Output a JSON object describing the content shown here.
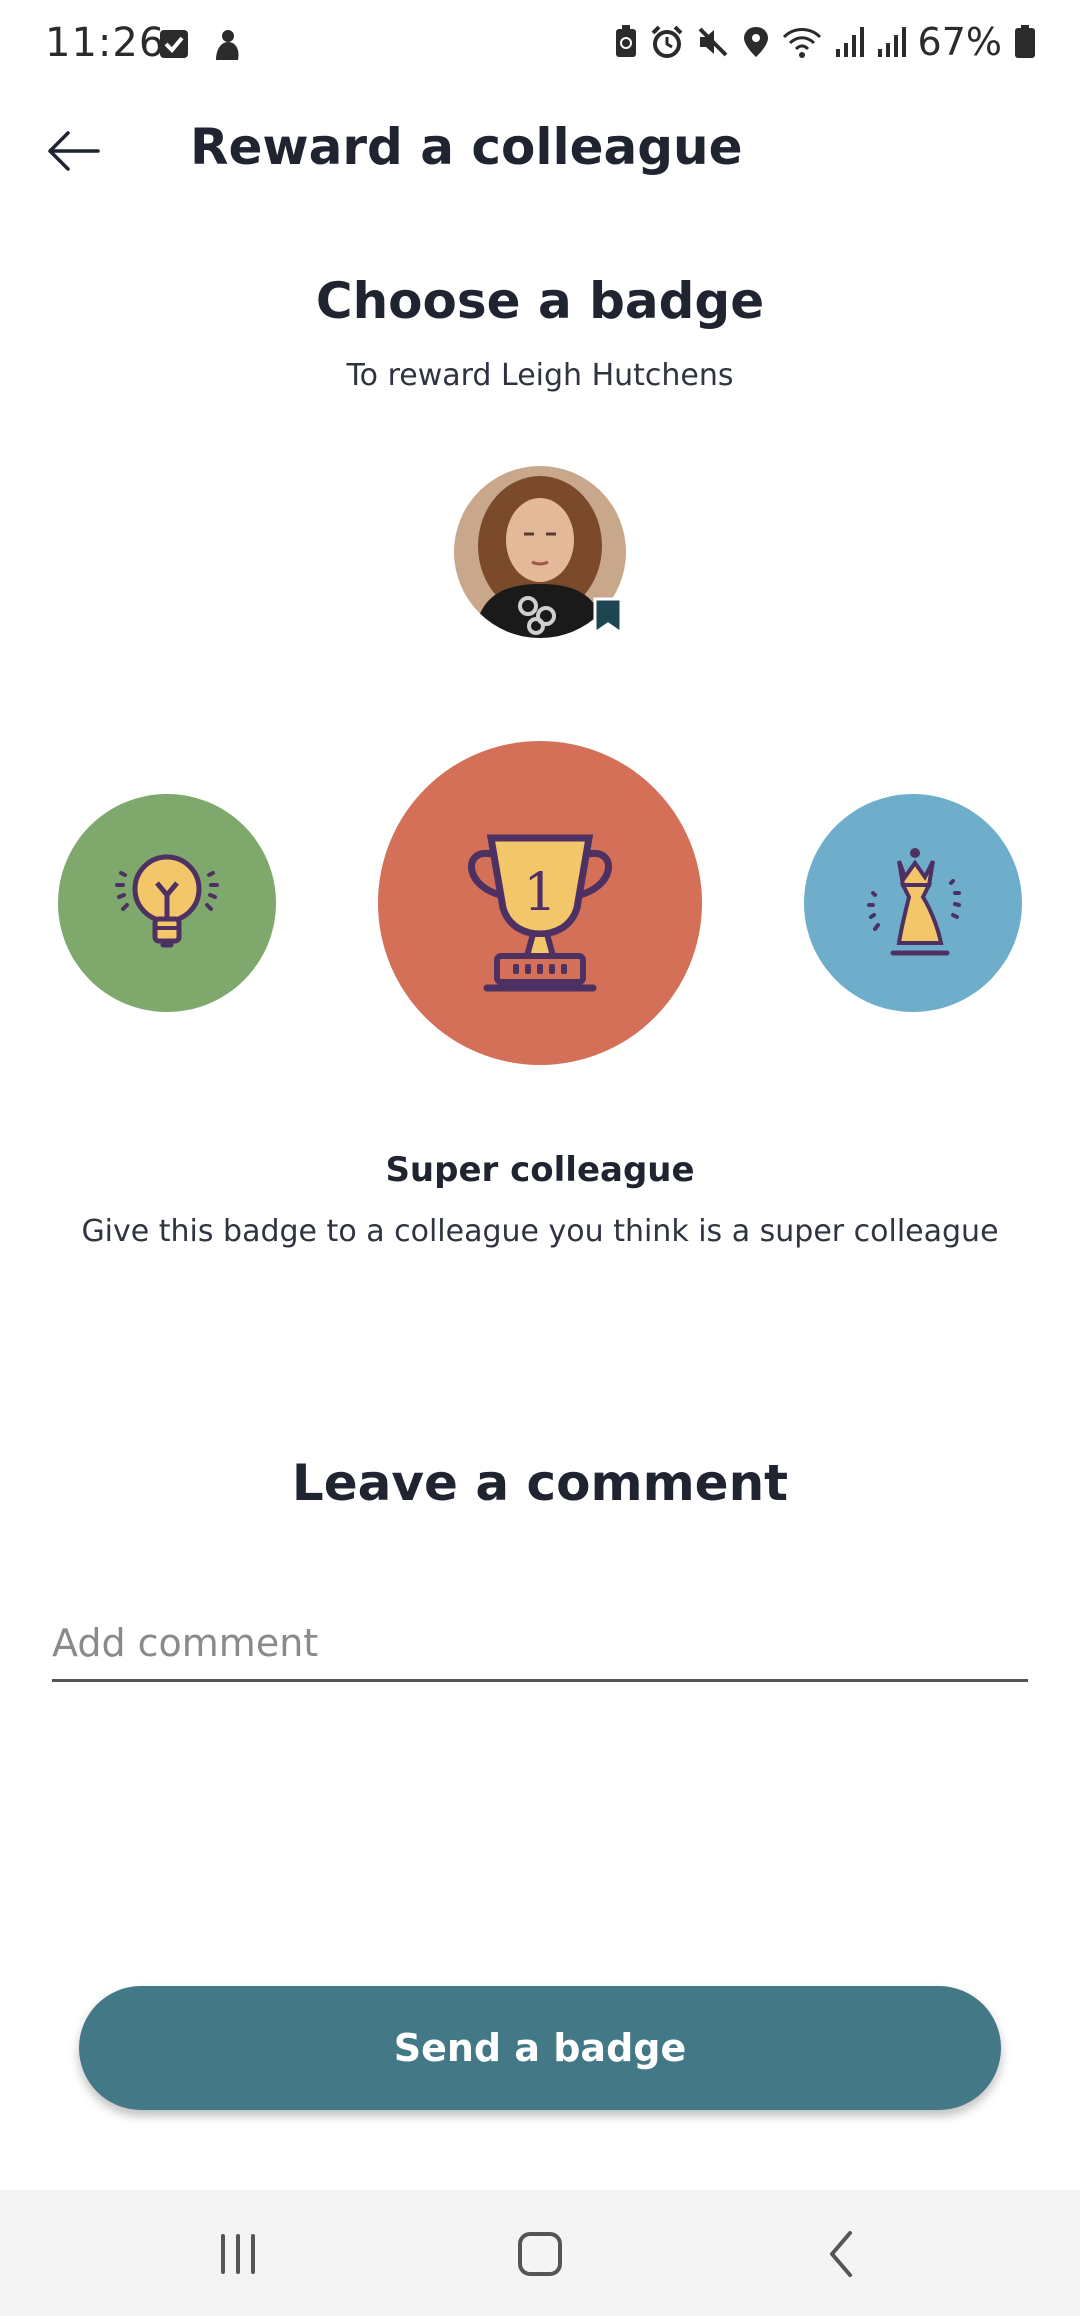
{
  "status_bar": {
    "time": "11:26",
    "battery": "67%",
    "left_icons": [
      "checkbox-icon",
      "notification-icon"
    ],
    "right_icons": [
      "battery-saver-icon",
      "alarm-icon",
      "mute-icon",
      "location-icon",
      "wifi-icon",
      "signal-icon",
      "signal-icon"
    ]
  },
  "app_bar": {
    "title": "Reward a colleague",
    "back_icon": "arrow-left-icon"
  },
  "badge_section": {
    "title": "Choose a badge",
    "subtitle": "To reward Leigh Hutchens"
  },
  "badges": [
    {
      "icon": "lightbulb-icon",
      "color": "#7ea86c"
    },
    {
      "icon": "trophy-icon",
      "color": "#d46f58",
      "selected": true
    },
    {
      "icon": "chess-queen-icon",
      "color": "#6faecb"
    }
  ],
  "selected_badge": {
    "name": "Super colleague",
    "description": "Give this badge to a colleague you think is a super colleague"
  },
  "comment_section": {
    "title": "Leave a comment",
    "placeholder": "Add comment"
  },
  "send_button": {
    "label": "Send a badge",
    "color": "#437886"
  },
  "nav_bar": {
    "buttons": [
      "recents-icon",
      "home-icon",
      "back-icon"
    ]
  }
}
